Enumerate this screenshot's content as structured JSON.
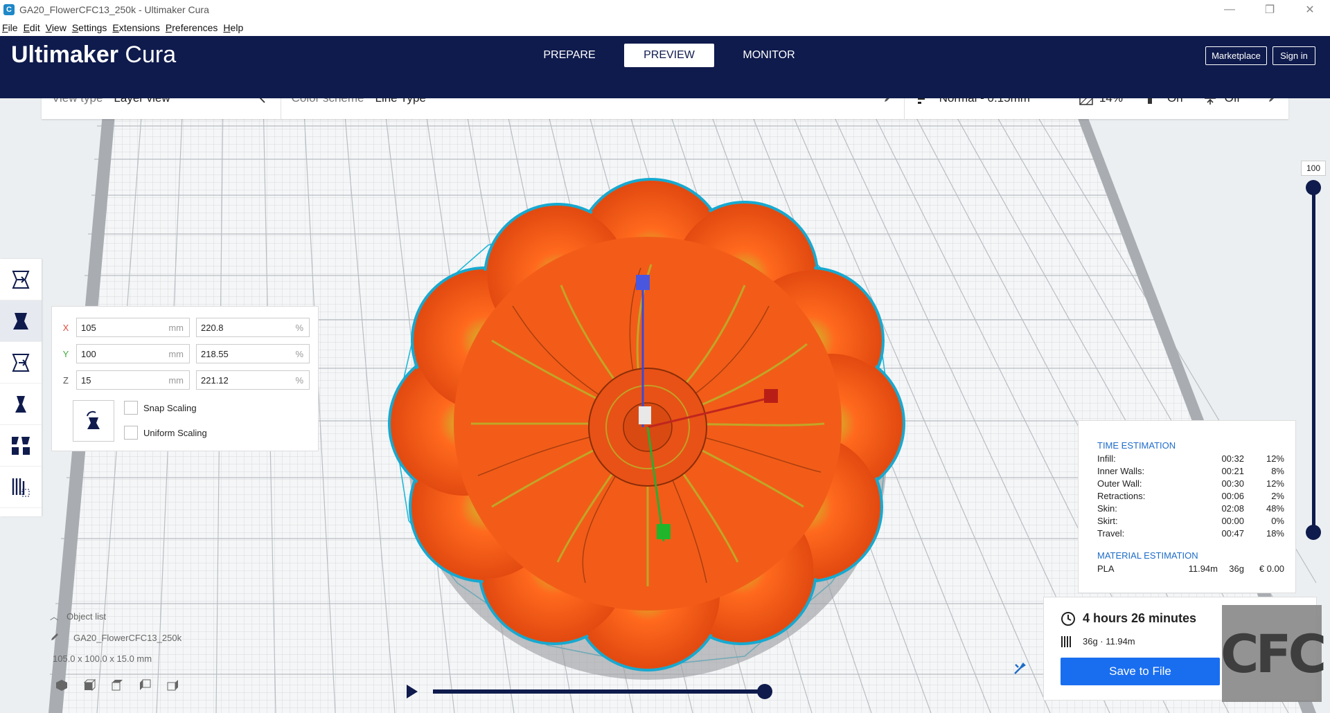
{
  "window": {
    "title": "GA20_FlowerCFC13_250k - Ultimaker Cura",
    "controls": [
      "—",
      "❐",
      "✕"
    ]
  },
  "menu": [
    "File",
    "Edit",
    "View",
    "Settings",
    "Extensions",
    "Preferences",
    "Help"
  ],
  "header": {
    "brand_bold": "Ultimaker",
    "brand_light": "Cura",
    "stages": [
      "PREPARE",
      "PREVIEW",
      "MONITOR"
    ],
    "active_stage": "PREVIEW",
    "marketplace_label": "Marketplace",
    "signin_label": "Sign in",
    "background_color": "#0f1b4d"
  },
  "view_bar": {
    "view_type_label": "View type",
    "view_type_value": "Layer view",
    "color_scheme_label": "Color scheme",
    "color_scheme_value": "Line Type",
    "profile": "Normal - 0.15mm",
    "infill": "14%",
    "support": "On",
    "adhesion": "Off"
  },
  "tools": [
    "move-tool",
    "scale-tool",
    "rotate-tool",
    "mirror-tool",
    "per-model-settings-tool",
    "support-blocker-tool"
  ],
  "active_tool": "scale-tool",
  "scale_panel": {
    "x": {
      "label": "X",
      "mm": "105",
      "percent": "220.8",
      "color": "#e24b3a"
    },
    "y": {
      "label": "Y",
      "mm": "100",
      "percent": "218.55",
      "color": "#3fae3a"
    },
    "z": {
      "label": "Z",
      "mm": "15",
      "percent": "221.12",
      "color": "#555555"
    },
    "unit_mm": "mm",
    "unit_percent": "%",
    "snap_scaling": "Snap Scaling",
    "uniform_scaling": "Uniform Scaling"
  },
  "layer_slider": {
    "value": "100"
  },
  "time_estimation": {
    "title": "TIME ESTIMATION",
    "rows": [
      {
        "name": "Infill:",
        "time": "00:32",
        "pct": "12%"
      },
      {
        "name": "Inner Walls:",
        "time": "00:21",
        "pct": "8%"
      },
      {
        "name": "Outer Wall:",
        "time": "00:30",
        "pct": "12%"
      },
      {
        "name": "Retractions:",
        "time": "00:06",
        "pct": "2%"
      },
      {
        "name": "Skin:",
        "time": "02:08",
        "pct": "48%"
      },
      {
        "name": "Skirt:",
        "time": "00:00",
        "pct": "0%"
      },
      {
        "name": "Travel:",
        "time": "00:47",
        "pct": "18%"
      }
    ]
  },
  "material_estimation": {
    "title": "MATERIAL ESTIMATION",
    "material": "PLA",
    "length": "11.94m",
    "weight": "36g",
    "cost": "€ 0.00"
  },
  "print": {
    "time": "4 hours 26 minutes",
    "material_summary": "36g · 11.94m",
    "save_label": "Save to File"
  },
  "object_list": {
    "title": "Object list",
    "object_name": "GA20_FlowerCFC13_250k",
    "dimensions": "105.0 x 100.0 x 15.0 mm"
  },
  "watermark": "CFC",
  "colors": {
    "accent": "#196ef0",
    "model": "#f05a1a",
    "outline": "#1fb8d8"
  }
}
